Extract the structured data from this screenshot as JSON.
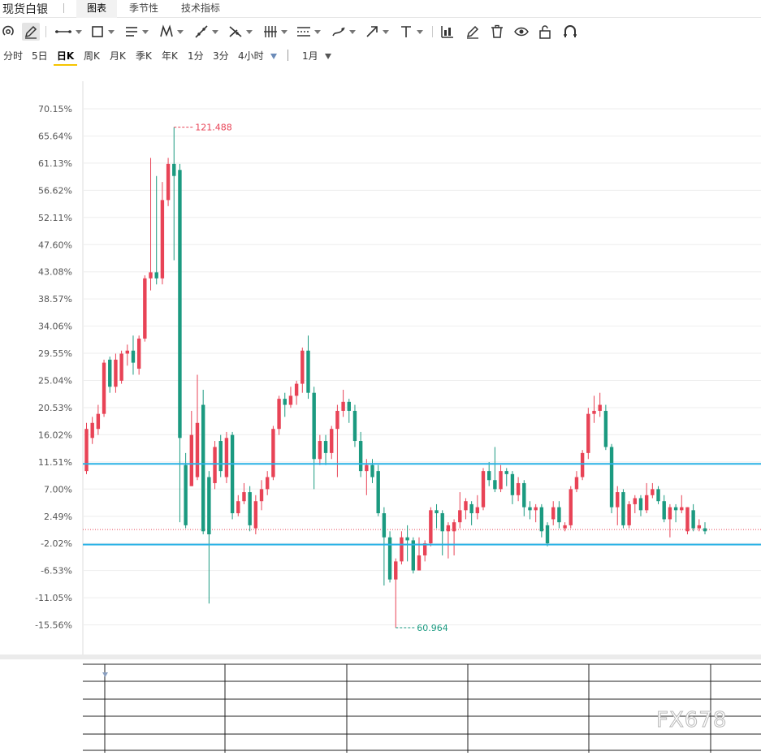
{
  "app": {
    "title": "现货白银"
  },
  "top_tabs": [
    {
      "label": "图表",
      "active": true
    },
    {
      "label": "季节性",
      "active": false
    },
    {
      "label": "技术指标",
      "active": false
    }
  ],
  "toolbar": {
    "tools": [
      "undo-icon",
      "pencil-icon",
      "line-tool-icon",
      "rectangle-tool-icon",
      "list-lines-icon",
      "pattern-tool-icon",
      "trend-tool-icon",
      "fork-tool-icon",
      "vertical-lines-icon",
      "channel-tool-icon",
      "brush-tool-icon",
      "arrow-tool-icon",
      "text-tool-icon",
      "chart-stats-icon",
      "edit-icon",
      "trash-icon",
      "eye-icon",
      "unlock-icon",
      "magnet-icon"
    ]
  },
  "periods": {
    "items": [
      {
        "label": "分时",
        "active": false
      },
      {
        "label": "5日",
        "active": false
      },
      {
        "label": "日K",
        "active": true
      },
      {
        "label": "周K",
        "active": false
      },
      {
        "label": "月K",
        "active": false
      },
      {
        "label": "季K",
        "active": false
      },
      {
        "label": "年K",
        "active": false
      },
      {
        "label": "1分",
        "active": false
      },
      {
        "label": "3分",
        "active": false
      },
      {
        "label": "4小时",
        "active": false
      }
    ],
    "range_label": "1月"
  },
  "colors": {
    "up": "#e84356",
    "down": "#1b9a80",
    "hline": "#29b2e6",
    "grid": "#eeeeee",
    "max_label": "#e84356",
    "min_label": "#1b9a80"
  },
  "watermark": "FX678",
  "chart_data": {
    "type": "candlestick",
    "y_unit": "percent change",
    "y_ticks": [
      "70.15%",
      "65.64%",
      "61.13%",
      "56.62%",
      "52.11%",
      "47.60%",
      "43.08%",
      "38.57%",
      "34.06%",
      "29.55%",
      "25.04%",
      "20.53%",
      "16.02%",
      "11.51%",
      "7.00%",
      "2.49%",
      "-2.02%",
      "-6.53%",
      "-11.05%",
      "-15.56%"
    ],
    "ylim": [
      -17.5,
      73.6
    ],
    "reference_level_pct": 0.3,
    "horizontal_lines_pct": [
      11.2,
      -2.2
    ],
    "max_label": "121.488",
    "max_label_value_pct": 67.1,
    "min_label": "60.964",
    "min_label_value_pct": -16.0,
    "candles": [
      [
        10.0,
        17.0,
        18.0,
        9.5
      ],
      [
        15.5,
        18.0,
        19.0,
        14.5
      ],
      [
        17.0,
        19.5,
        21.0,
        16.0
      ],
      [
        19.5,
        28.0,
        28.5,
        19.0
      ],
      [
        28.5,
        24.0,
        29.0,
        23.0
      ],
      [
        24.0,
        28.5,
        29.5,
        23.0
      ],
      [
        25.0,
        29.5,
        30.0,
        24.5
      ],
      [
        29.5,
        30.0,
        31.0,
        27.5
      ],
      [
        30.0,
        28.0,
        32.5,
        26.0
      ],
      [
        27.0,
        32.0,
        32.5,
        26.0
      ],
      [
        32.0,
        42.0,
        42.5,
        31.5
      ],
      [
        42.0,
        43.0,
        62.0,
        40.0
      ],
      [
        43.0,
        42.0,
        59.0,
        41.0
      ],
      [
        42.0,
        55.0,
        58.0,
        41.0
      ],
      [
        55.0,
        61.0,
        62.0,
        54.0
      ],
      [
        61.0,
        59.0,
        67.1,
        45.0
      ],
      [
        60.0,
        15.5,
        61.0,
        1.5
      ],
      [
        11.0,
        1.0,
        13.0,
        0.5
      ],
      [
        7.5,
        16.0,
        20.0,
        7.5
      ],
      [
        9.0,
        18.0,
        26.0,
        8.5
      ],
      [
        21.0,
        0.0,
        23.5,
        -0.5
      ],
      [
        9.0,
        -0.5,
        10.0,
        -12.0
      ],
      [
        8.0,
        14.0,
        15.0,
        7.0
      ],
      [
        15.0,
        10.0,
        16.0,
        9.0
      ],
      [
        9.0,
        15.5,
        16.5,
        8.0
      ],
      [
        16.0,
        3.0,
        16.5,
        2.0
      ],
      [
        3.0,
        5.0,
        6.0,
        2.5
      ],
      [
        5.0,
        6.5,
        8.0,
        4.5
      ],
      [
        6.5,
        1.0,
        7.5,
        0.0
      ],
      [
        0.5,
        5.0,
        6.0,
        -0.5
      ],
      [
        5.0,
        7.0,
        8.5,
        3.5
      ],
      [
        7.0,
        9.0,
        10.0,
        6.0
      ],
      [
        9.0,
        17.0,
        17.5,
        8.5
      ],
      [
        17.0,
        22.0,
        22.5,
        16.0
      ],
      [
        22.0,
        21.0,
        23.0,
        19.0
      ],
      [
        21.0,
        22.5,
        24.0,
        20.5
      ],
      [
        22.5,
        24.5,
        25.0,
        21.0
      ],
      [
        24.5,
        30.0,
        30.5,
        23.0
      ],
      [
        30.0,
        23.0,
        32.5,
        22.0
      ],
      [
        23.0,
        12.0,
        24.0,
        7.0
      ],
      [
        12.0,
        15.0,
        16.0,
        11.0
      ],
      [
        15.0,
        13.0,
        16.0,
        11.0
      ],
      [
        13.0,
        17.0,
        17.5,
        12.0
      ],
      [
        17.0,
        20.0,
        21.0,
        9.0
      ],
      [
        20.0,
        21.5,
        23.5,
        19.0
      ],
      [
        21.5,
        20.0,
        22.0,
        18.0
      ],
      [
        20.0,
        15.0,
        21.0,
        14.0
      ],
      [
        15.0,
        10.0,
        16.5,
        9.0
      ],
      [
        10.0,
        11.0,
        12.0,
        6.0
      ],
      [
        11.0,
        9.0,
        12.0,
        8.0
      ],
      [
        10.0,
        3.0,
        11.0,
        2.5
      ],
      [
        3.0,
        -1.0,
        4.0,
        -9.0
      ],
      [
        -1.0,
        -8.0,
        0.0,
        -8.5
      ],
      [
        -8.0,
        -5.0,
        -4.5,
        -16.0
      ],
      [
        -5.0,
        -1.0,
        0.0,
        -5.5
      ],
      [
        -1.0,
        -1.5,
        1.0,
        -5.0
      ],
      [
        -1.5,
        -6.5,
        -1.0,
        -7.0
      ],
      [
        -6.5,
        -4.0,
        -1.0,
        -6.0
      ],
      [
        -4.0,
        -2.0,
        -1.5,
        -5.0
      ],
      [
        -2.0,
        3.5,
        4.0,
        -2.5
      ],
      [
        3.5,
        3.0,
        4.5,
        0.5
      ],
      [
        3.0,
        0.0,
        3.5,
        -4.0
      ],
      [
        0.0,
        1.0,
        1.5,
        -4.5
      ],
      [
        0.0,
        1.5,
        2.0,
        -4.0
      ],
      [
        1.5,
        3.5,
        6.5,
        0.5
      ],
      [
        3.5,
        5.0,
        5.5,
        2.0
      ],
      [
        4.5,
        3.0,
        5.0,
        1.0
      ],
      [
        3.0,
        4.0,
        6.0,
        2.0
      ],
      [
        4.0,
        10.0,
        10.5,
        3.5
      ],
      [
        10.0,
        8.5,
        11.5,
        7.5
      ],
      [
        8.5,
        7.0,
        14.0,
        6.5
      ],
      [
        7.0,
        10.0,
        11.0,
        6.5
      ],
      [
        10.0,
        9.5,
        10.5,
        7.5
      ],
      [
        9.5,
        6.0,
        10.0,
        4.5
      ],
      [
        6.0,
        8.0,
        9.0,
        5.0
      ],
      [
        8.0,
        4.0,
        8.5,
        2.5
      ],
      [
        4.0,
        3.5,
        5.0,
        2.0
      ],
      [
        3.5,
        4.0,
        4.5,
        1.5
      ],
      [
        4.0,
        0.0,
        4.5,
        -1.0
      ],
      [
        1.0,
        -2.0,
        1.5,
        -2.5
      ],
      [
        2.0,
        4.0,
        5.0,
        1.0
      ],
      [
        4.0,
        1.5,
        5.0,
        0.5
      ],
      [
        0.5,
        1.0,
        1.5,
        0.0
      ],
      [
        1.0,
        7.0,
        7.5,
        0.5
      ],
      [
        7.0,
        9.0,
        10.0,
        6.5
      ],
      [
        9.0,
        13.0,
        13.5,
        8.5
      ],
      [
        13.0,
        19.5,
        20.5,
        12.0
      ],
      [
        19.5,
        20.0,
        22.5,
        18.0
      ],
      [
        20.0,
        21.0,
        23.0,
        19.0
      ],
      [
        20.0,
        14.0,
        21.0,
        13.5
      ],
      [
        14.0,
        4.0,
        14.5,
        3.0
      ],
      [
        4.0,
        6.5,
        7.5,
        1.0
      ],
      [
        6.5,
        1.0,
        7.0,
        0.5
      ],
      [
        1.0,
        4.5,
        5.0,
        0.5
      ],
      [
        4.5,
        5.5,
        6.0,
        3.0
      ],
      [
        5.5,
        3.5,
        6.0,
        2.5
      ],
      [
        3.5,
        6.0,
        8.0,
        3.0
      ],
      [
        6.0,
        7.0,
        8.0,
        5.5
      ],
      [
        7.0,
        5.0,
        7.5,
        4.5
      ],
      [
        5.0,
        2.0,
        6.0,
        1.5
      ],
      [
        2.0,
        4.0,
        4.5,
        -1.0
      ],
      [
        4.0,
        3.5,
        4.5,
        1.5
      ],
      [
        3.5,
        4.0,
        6.0,
        3.0
      ],
      [
        0.0,
        4.0,
        4.0,
        -0.5
      ],
      [
        3.5,
        0.5,
        4.5,
        0.0
      ],
      [
        0.5,
        1.0,
        2.0,
        0.0
      ],
      [
        0.5,
        0.0,
        1.5,
        -0.5
      ]
    ]
  }
}
